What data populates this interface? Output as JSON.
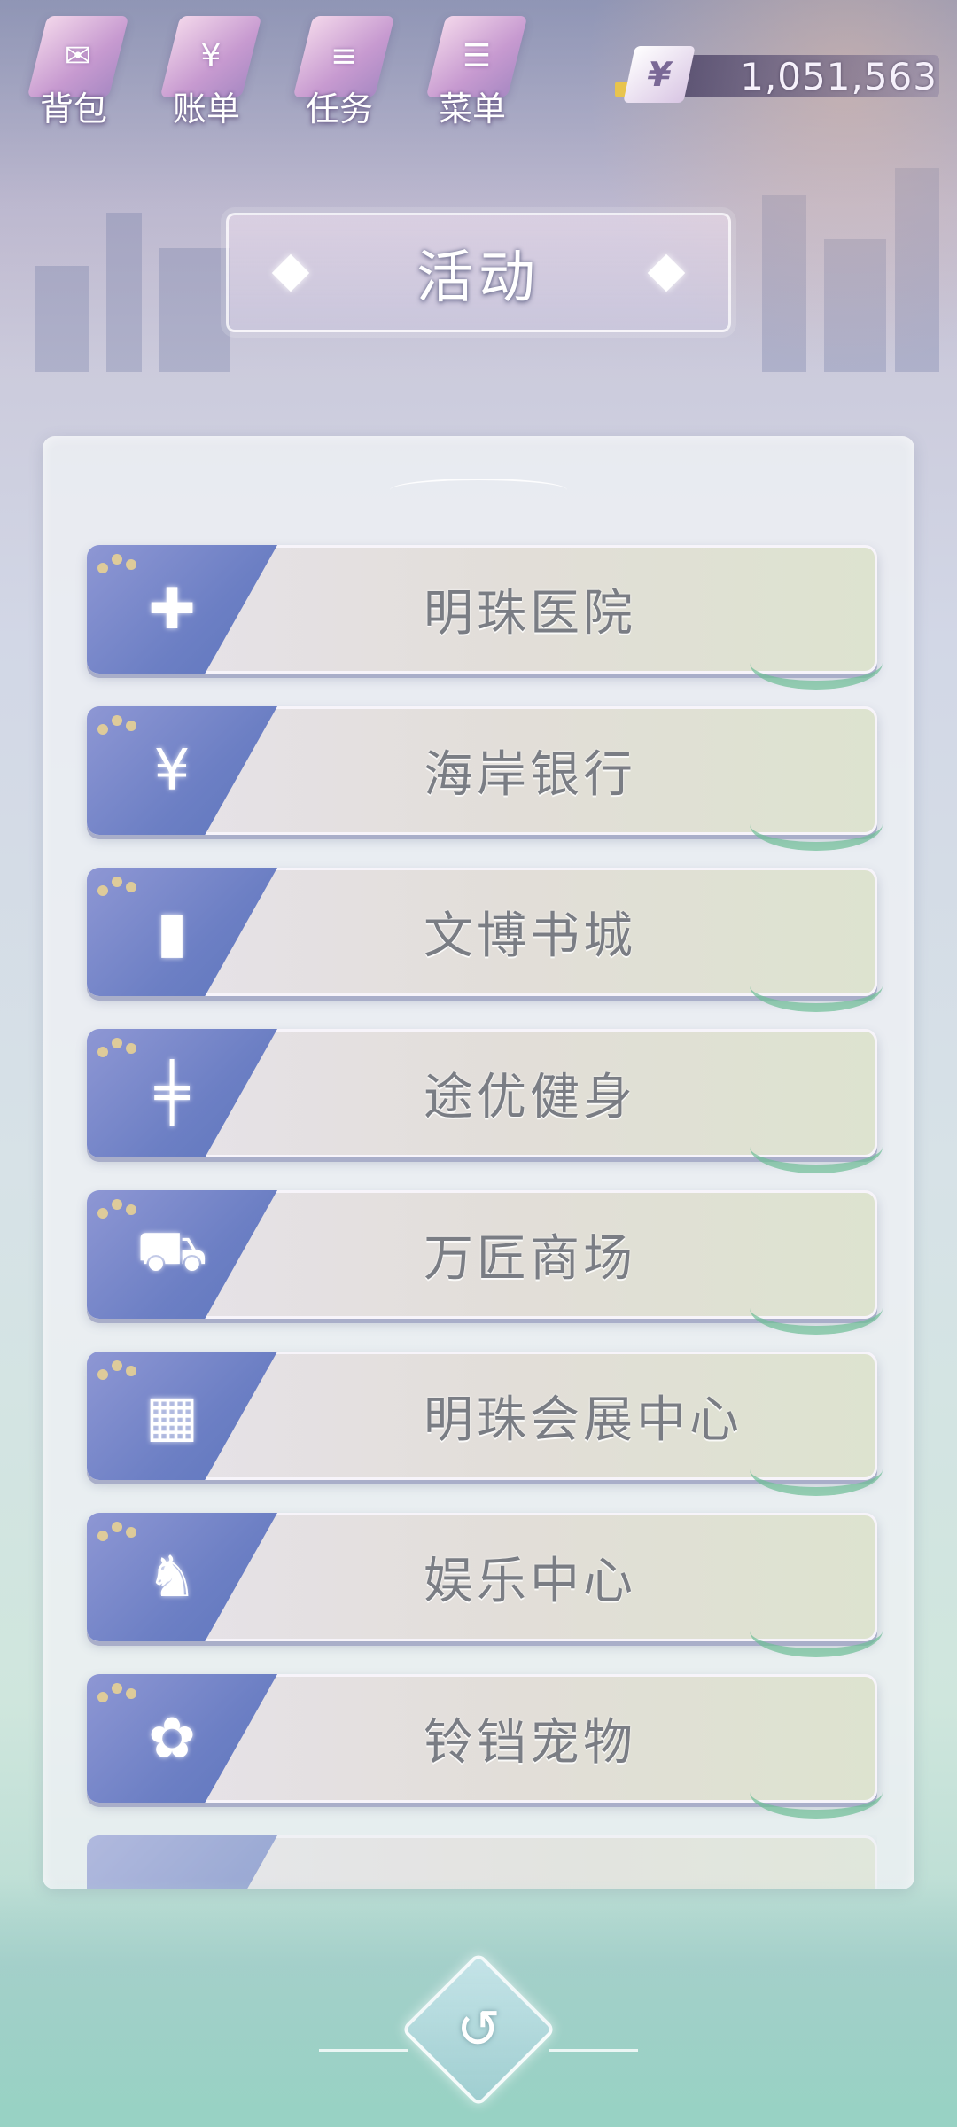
{
  "topbar": {
    "buttons": [
      {
        "label": "背包",
        "icon": "backpack-icon",
        "glyph": "✉"
      },
      {
        "label": "账单",
        "icon": "bill-icon",
        "glyph": "¥"
      },
      {
        "label": "任务",
        "icon": "task-icon",
        "glyph": "≡"
      },
      {
        "label": "菜单",
        "icon": "menu-icon",
        "glyph": "☰"
      }
    ],
    "currency": {
      "symbol": "¥",
      "amount": "1,051,563"
    }
  },
  "title": "活动",
  "locations": [
    {
      "name": "明珠医院",
      "icon": "hospital-cross-icon",
      "glyph": "✚"
    },
    {
      "name": "海岸银行",
      "icon": "coins-icon",
      "glyph": "¥"
    },
    {
      "name": "文博书城",
      "icon": "book-icon",
      "glyph": "▮"
    },
    {
      "name": "途优健身",
      "icon": "dumbbell-icon",
      "glyph": "╪"
    },
    {
      "name": "万匠商场",
      "icon": "shopping-cart-icon",
      "glyph": "⛟"
    },
    {
      "name": "明珠会展中心",
      "icon": "building-icon",
      "glyph": "▦"
    },
    {
      "name": "娱乐中心",
      "icon": "chess-icon",
      "glyph": "♞"
    },
    {
      "name": "铃铛宠物",
      "icon": "paw-icon",
      "glyph": "✿"
    }
  ],
  "back": {
    "icon": "back-arrow-icon",
    "glyph": "↺"
  },
  "colors": {
    "tab": "#6c7fc4",
    "label": "#7a7d84",
    "accent_leaf": "#6ebe96"
  }
}
